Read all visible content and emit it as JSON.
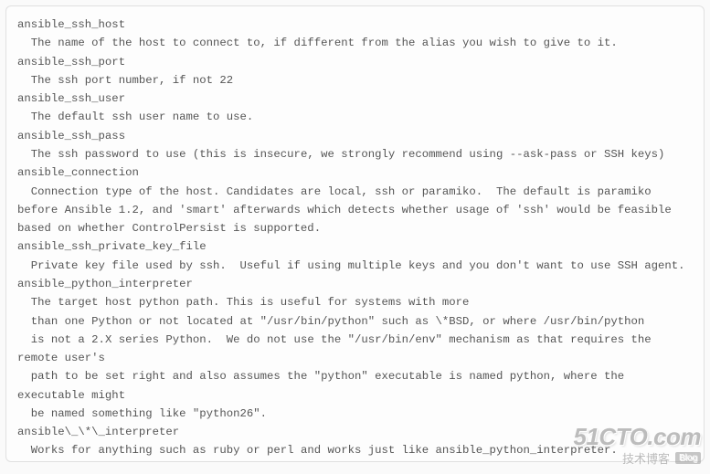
{
  "entries": [
    {
      "term": "ansible_ssh_host",
      "desc": "The name of the host to connect to, if different from the alias you wish to give to it."
    },
    {
      "term": "ansible_ssh_port",
      "desc": "The ssh port number, if not 22"
    },
    {
      "term": "ansible_ssh_user",
      "desc": "The default ssh user name to use."
    },
    {
      "term": "ansible_ssh_pass",
      "desc": "The ssh password to use (this is insecure, we strongly recommend using --ask-pass or SSH keys)"
    },
    {
      "term": "ansible_connection",
      "desc": "Connection type of the host. Candidates are local, ssh or paramiko.  The default is paramiko before Ansible 1.2, and 'smart' afterwards which detects whether usage of 'ssh' would be feasible based on whether ControlPersist is supported."
    },
    {
      "term": "ansible_ssh_private_key_file",
      "desc": "Private key file used by ssh.  Useful if using multiple keys and you don't want to use SSH agent."
    },
    {
      "term": "ansible_python_interpreter",
      "desc": "The target host python path. This is useful for systems with more\n  than one Python or not located at \"/usr/bin/python\" such as \\*BSD, or where /usr/bin/python\n  is not a 2.X series Python.  We do not use the \"/usr/bin/env\" mechanism as that requires the remote user's\n  path to be set right and also assumes the \"python\" executable is named python, where the executable might\n  be named something like \"python26\"."
    },
    {
      "term": "ansible\\_\\*\\_interpreter",
      "desc": "Works for anything such as ruby or perl and works just like ansible_python_interpreter.\n  This replaces shebang of modules which will run on that host."
    }
  ],
  "watermark": {
    "domain": "51CTO.com",
    "sub": "技术博客",
    "blog": "Blog"
  }
}
